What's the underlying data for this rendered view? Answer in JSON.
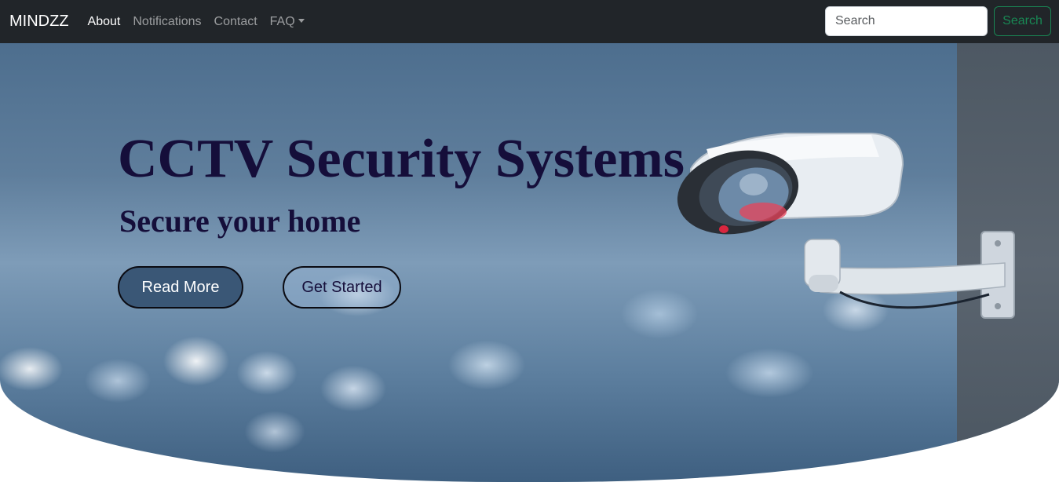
{
  "navbar": {
    "brand": "MINDZZ",
    "links": [
      {
        "label": "About",
        "active": true
      },
      {
        "label": "Notifications"
      },
      {
        "label": "Contact"
      },
      {
        "label": "FAQ",
        "dropdown": true
      }
    ],
    "search": {
      "placeholder": "Search",
      "value": "",
      "button_label": "Search"
    }
  },
  "hero": {
    "title": "CCTV Security Systems",
    "subtitle": "Secure your home",
    "primary_button": "Read More",
    "secondary_button": "Get Started",
    "background_image": "cctv-camera-bokeh"
  },
  "colors": {
    "navbar_bg": "#212529",
    "search_button": "#198754",
    "hero_text": "#150e3a",
    "read_more_bg": "#3a5776"
  }
}
